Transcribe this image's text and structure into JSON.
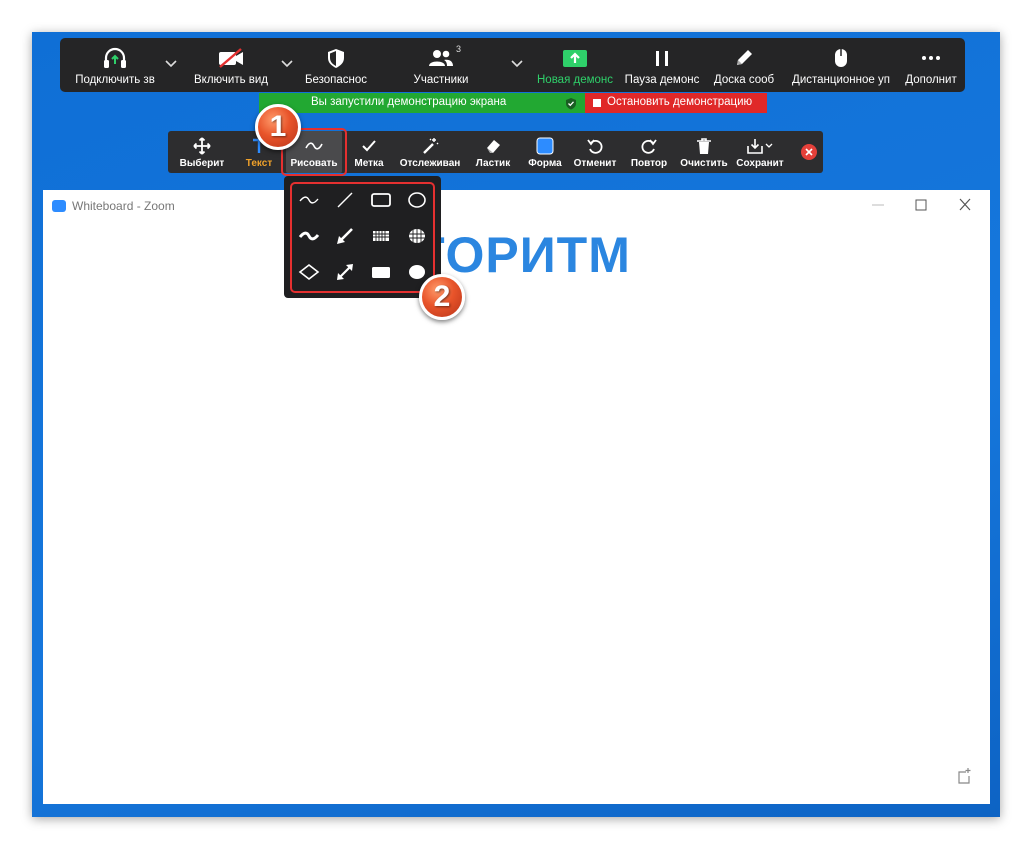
{
  "meeting_bar": {
    "items": [
      {
        "label": "Подключить зв",
        "icon": "headphones-icon"
      },
      {
        "label": "Включить вид",
        "icon": "video-off-icon"
      },
      {
        "label": "Безопаснос",
        "icon": "shield-icon"
      },
      {
        "label": "Участники",
        "icon": "participants-icon",
        "badge": "3"
      },
      {
        "label": "Новая демонс",
        "icon": "share-screen-icon"
      },
      {
        "label": "Пауза демонс",
        "icon": "pause-icon"
      },
      {
        "label": "Доска сооб",
        "icon": "pencil-icon"
      },
      {
        "label": "Дистанционное уп",
        "icon": "mouse-icon"
      },
      {
        "label": "Дополнит",
        "icon": "more-icon"
      }
    ]
  },
  "share_banner": {
    "text": "Вы запустили демонстрацию экрана",
    "stop_label": "Остановить демонстрацию"
  },
  "annotation_toolbar": {
    "items": [
      {
        "label": "Выберит",
        "icon": "move-icon"
      },
      {
        "label": "Текст",
        "icon": "text-icon"
      },
      {
        "label": "Рисовать",
        "icon": "draw-squiggle-icon"
      },
      {
        "label": "Метка",
        "icon": "checkmark-icon"
      },
      {
        "label": "Отслеживан",
        "icon": "magic-wand-icon"
      },
      {
        "label": "Ластик",
        "icon": "eraser-icon"
      },
      {
        "label": "Форма",
        "icon": "format-color-icon"
      },
      {
        "label": "Отменит",
        "icon": "undo-icon"
      },
      {
        "label": "Повтор",
        "icon": "redo-icon"
      },
      {
        "label": "Очистить",
        "icon": "trash-icon"
      },
      {
        "label": "Сохранит",
        "icon": "save-icon"
      }
    ],
    "active": "Рисовать"
  },
  "whiteboard": {
    "title": "Whiteboard - Zoom",
    "content_text": "АЛГОРИТМ"
  },
  "draw_menu": {
    "tools": [
      "freehand-thin-icon",
      "line-icon",
      "rectangle-outline-icon",
      "ellipse-outline-icon",
      "freehand-thick-icon",
      "arrow-icon",
      "rectangle-pattern-icon",
      "ellipse-pattern-icon",
      "diamond-outline-icon",
      "double-arrow-icon",
      "rectangle-filled-icon",
      "ellipse-filled-icon"
    ]
  },
  "markers": {
    "step1": "1",
    "step2": "2"
  },
  "colors": {
    "desktop": "#1677dc",
    "toolbar": "#252526",
    "share_green": "#22a832",
    "stop_red": "#e02828",
    "highlight": "#e53030",
    "whiteboard_text": "#2b86e0"
  }
}
